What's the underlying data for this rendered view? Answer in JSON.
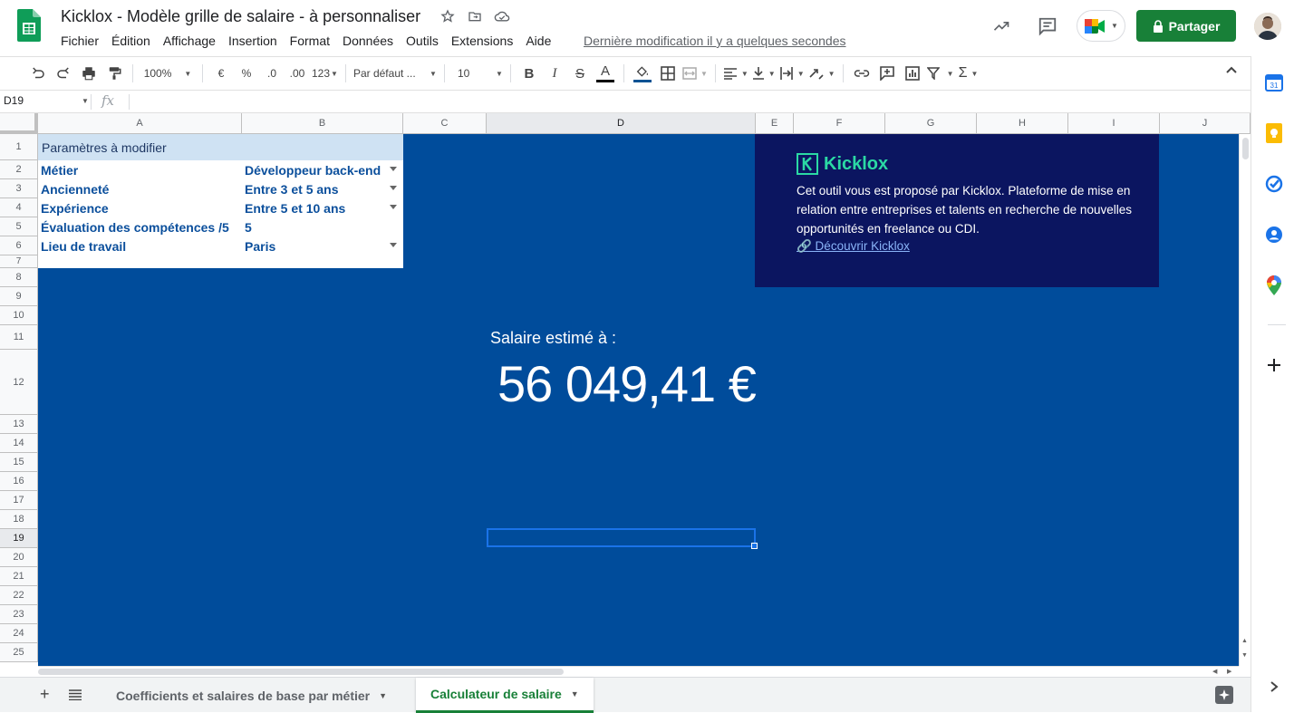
{
  "header": {
    "title": "Kicklox - Modèle grille de salaire - à personnaliser",
    "menu": [
      "Fichier",
      "Édition",
      "Affichage",
      "Insertion",
      "Format",
      "Données",
      "Outils",
      "Extensions",
      "Aide"
    ],
    "last_edit": "Dernière modification il y a quelques secondes",
    "share_label": "Partager"
  },
  "toolbar": {
    "zoom": "100%",
    "currency": "€",
    "percent": "%",
    "dec_less": ".0",
    "dec_more": ".00",
    "format_more": "123",
    "font": "Par défaut ...",
    "font_size": "10",
    "bold": "B",
    "italic": "I",
    "strike": "S",
    "text_color": "A"
  },
  "formula_bar": {
    "cell_ref": "D19",
    "fx": "fx"
  },
  "columns": [
    "A",
    "B",
    "C",
    "D",
    "E",
    "F",
    "G",
    "H",
    "I",
    "J"
  ],
  "rows": [
    "1",
    "2",
    "3",
    "4",
    "5",
    "6",
    "7",
    "8",
    "9",
    "10",
    "11",
    "12",
    "13",
    "14",
    "15",
    "16",
    "17",
    "18",
    "19",
    "20",
    "21",
    "22",
    "23",
    "24",
    "25"
  ],
  "params": {
    "header": "Paramètres à modifier",
    "items": [
      {
        "label": "Métier",
        "value": "Développeur back-end",
        "dropdown": true
      },
      {
        "label": "Ancienneté",
        "value": "Entre 3 et 5 ans",
        "dropdown": true
      },
      {
        "label": "Expérience",
        "value": "Entre 5 et 10 ans",
        "dropdown": true
      },
      {
        "label": "Évaluation des compétences /5",
        "value": "5",
        "dropdown": false
      },
      {
        "label": "Lieu de travail",
        "value": "Paris",
        "dropdown": true
      }
    ]
  },
  "promo": {
    "brand": "Kicklox",
    "text": "Cet outil vous est proposé par Kicklox. Plateforme de mise en relation entre entreprises et talents en recherche de nouvelles opportunités en freelance ou CDI.",
    "link": "🔗 Découvrir Kicklox"
  },
  "salary": {
    "label": "Salaire estimé à :",
    "value": "56 049,41 €"
  },
  "tabs": {
    "items": [
      {
        "label": "Coefficients et salaires de base par métier"
      },
      {
        "label": "Calculateur de salaire"
      }
    ]
  },
  "colors": {
    "sheet_bg": "#004c9b",
    "promo_bg": "#0b1560",
    "brand_green": "#2bd9a4",
    "share_green": "#188038"
  }
}
